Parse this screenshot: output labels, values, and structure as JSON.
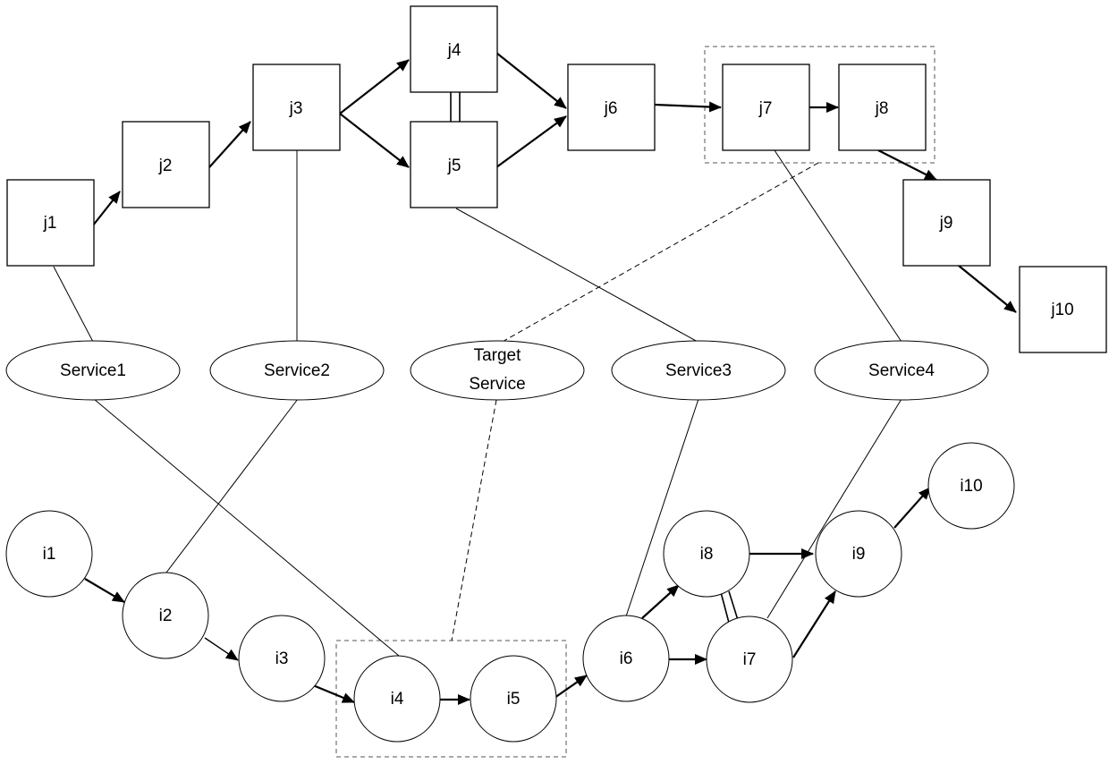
{
  "diagram": {
    "top_chain": {
      "nodes": [
        "j1",
        "j2",
        "j3",
        "j4",
        "j5",
        "j6",
        "j7",
        "j8",
        "j9",
        "j10"
      ],
      "edges": [
        [
          "j1",
          "j2"
        ],
        [
          "j2",
          "j3"
        ],
        [
          "j3",
          "j4"
        ],
        [
          "j3",
          "j5"
        ],
        [
          "j4",
          "j6"
        ],
        [
          "j5",
          "j6"
        ],
        [
          "j6",
          "j7"
        ],
        [
          "j7",
          "j8"
        ],
        [
          "j8",
          "j9"
        ],
        [
          "j9",
          "j10"
        ]
      ],
      "parallel_pairs": [
        [
          "j4",
          "j5"
        ]
      ],
      "grouped": [
        "j7",
        "j8"
      ]
    },
    "services": [
      "Service1",
      "Service2",
      "Target Service",
      "Service3",
      "Service4"
    ],
    "target_service_lines": [
      "Target",
      "Service"
    ],
    "bottom_chain": {
      "nodes": [
        "i1",
        "i2",
        "i3",
        "i4",
        "i5",
        "i6",
        "i7",
        "i8",
        "i9",
        "i10"
      ],
      "edges": [
        [
          "i1",
          "i2"
        ],
        [
          "i2",
          "i3"
        ],
        [
          "i3",
          "i4"
        ],
        [
          "i4",
          "i5"
        ],
        [
          "i5",
          "i6"
        ],
        [
          "i6",
          "i8"
        ],
        [
          "i6",
          "i7"
        ],
        [
          "i8",
          "i9"
        ],
        [
          "i7",
          "i9"
        ],
        [
          "i9",
          "i10"
        ]
      ],
      "parallel_pairs": [
        [
          "i8",
          "i7"
        ]
      ],
      "grouped": [
        "i4",
        "i5"
      ]
    },
    "associations": [
      {
        "service": "Service1",
        "top": "j1",
        "bottom": "i4"
      },
      {
        "service": "Service2",
        "top": "j3",
        "bottom": "i2"
      },
      {
        "service": "Target Service",
        "top": "j7-j8 group",
        "bottom": "i4-i5 group",
        "style": "dashed"
      },
      {
        "service": "Service3",
        "top": "j5",
        "bottom": "i6"
      },
      {
        "service": "Service4",
        "top": "j7",
        "bottom": "i7"
      }
    ]
  }
}
